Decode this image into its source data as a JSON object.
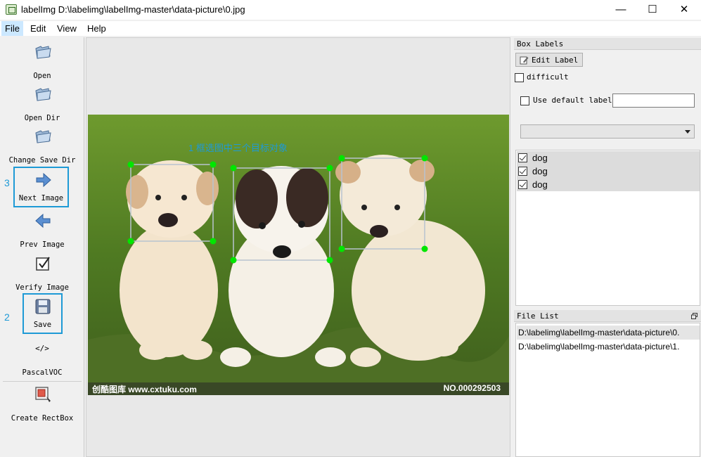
{
  "window": {
    "title": "labelImg D:\\labelimg\\labelImg-master\\data-picture\\0.jpg",
    "controls": {
      "minimize": "—",
      "maximize": "☐",
      "close": "✕"
    }
  },
  "menu": [
    "File",
    "Edit",
    "View",
    "Help"
  ],
  "toolbar": {
    "open": "Open",
    "open_dir": "Open Dir",
    "change_save_dir": "Change Save Dir",
    "next_image": "Next Image",
    "prev_image": "Prev Image",
    "verify_image": "Verify Image",
    "save": "Save",
    "format_icon": "</>",
    "format": "PascalVOC",
    "create_rectbox": "Create RectBox"
  },
  "step_markers": {
    "next_image": "3",
    "save": "2"
  },
  "canvas": {
    "annotation": "1  框选图中三个目标对象",
    "watermark_left": "创酷图库    www.cxtuku.com",
    "watermark_right": "NO.000292503"
  },
  "box_labels": {
    "title": "Box Labels",
    "edit_label": "Edit Label",
    "difficult": "difficult",
    "use_default_label": "Use default label",
    "default_label_value": "",
    "dropdown_value": "",
    "labels": [
      {
        "text": "dog",
        "checked": true
      },
      {
        "text": "dog",
        "checked": true
      },
      {
        "text": "dog",
        "checked": true
      }
    ]
  },
  "file_list": {
    "title": "File List",
    "files": [
      "D:\\labelimg\\labelImg-master\\data-picture\\0.",
      "D:\\labelimg\\labelImg-master\\data-picture\\1."
    ]
  },
  "colors": {
    "highlight": "#1e9ad6",
    "bbox_handle": "#00e600",
    "menu_active": "#cce8ff"
  }
}
